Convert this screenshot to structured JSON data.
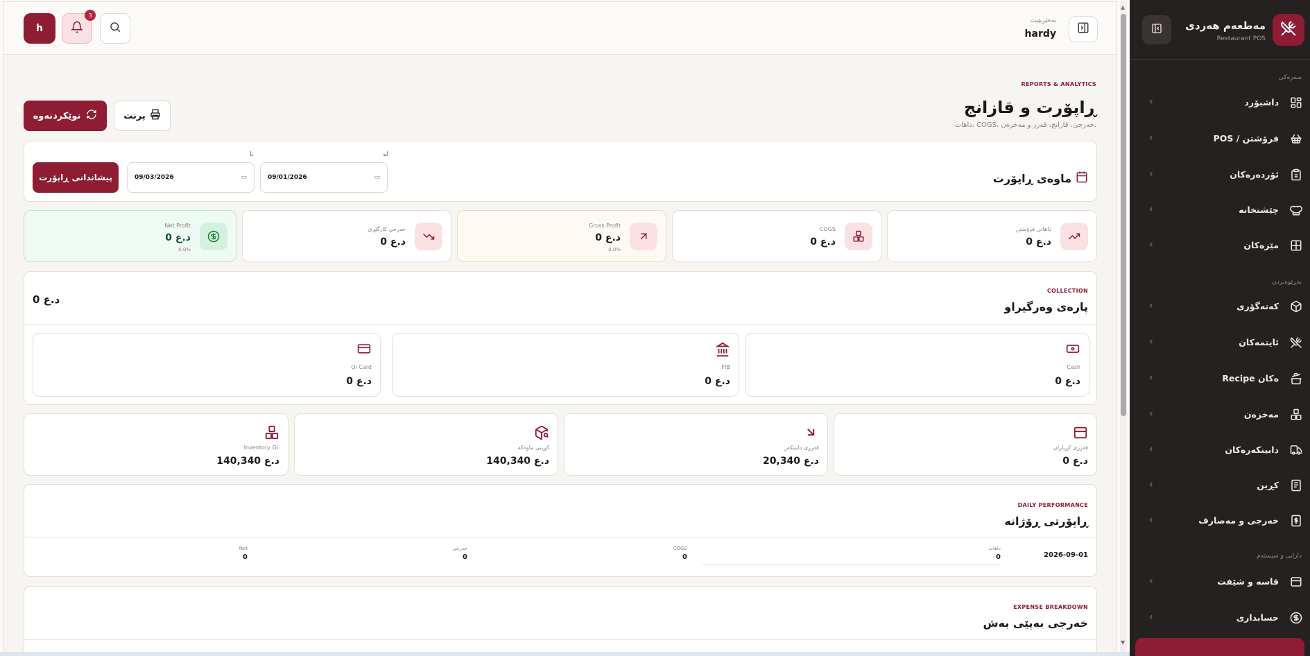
{
  "topbar": {
    "avatar_initial": "h",
    "notifications_count": "3",
    "welcome_label": "بەخێربێیت",
    "username": "hardy"
  },
  "sidebar": {
    "brand_name": "مەطعەم هەردی",
    "brand_sub": "Restaurant POS",
    "sections": {
      "main": "سەرەکی",
      "management": "بەڕێوەبردن",
      "finance": "دارایی و سیستەم"
    },
    "items": [
      {
        "label": "داشبۆرد",
        "icon": "dashboard-icon"
      },
      {
        "label": "POS / فرۆشتن",
        "icon": "basket-icon"
      },
      {
        "label": "ئۆردەرەکان",
        "icon": "clipboard-icon"
      },
      {
        "label": "چێشتخانە",
        "icon": "chef-hat-icon"
      },
      {
        "label": "مێزەکان",
        "icon": "table-grid-icon"
      },
      {
        "label": "کەتەگۆری",
        "icon": "box-icon"
      },
      {
        "label": "ئایتمەکان",
        "icon": "utensils-icon"
      },
      {
        "label": "Recipe ەکان",
        "icon": "cooking-pot-icon"
      },
      {
        "label": "مەخزەن",
        "icon": "boxes-icon"
      },
      {
        "label": "دابینکەرەکان",
        "icon": "truck-icon"
      },
      {
        "label": "کڕین",
        "icon": "receipt-icon"
      },
      {
        "label": "خەرجی و مەصارف",
        "icon": "dollar-receipt-icon"
      },
      {
        "label": "قاسە و شێفت",
        "icon": "cash-register-icon"
      },
      {
        "label": "حسابداری",
        "icon": "dollar-circle-icon"
      }
    ]
  },
  "page": {
    "eyebrow": "REPORTS & ANALYTICS",
    "title": "ڕاپۆرت و قازانج",
    "subtitle": "داهات، COGS، خەرجی، قازانج، قەرز و مەخزەن.",
    "refresh_label": "نوێکردنەوە",
    "print_label": "پرنت"
  },
  "filter": {
    "title": "ماوەی ڕاپۆرت",
    "from_label": "لە",
    "to_label": "تا",
    "from_value": "09/01/2026",
    "to_value": "09/03/2026",
    "show_button": "پیشاندانی ڕاپۆرت"
  },
  "kpis": [
    {
      "label": "داهاتی فرۆشتن",
      "value": "0 د.ع",
      "sub": "",
      "icon": "trending-up-icon"
    },
    {
      "label": "COGS",
      "value": "0 د.ع",
      "sub": "",
      "icon": "boxes-icon"
    },
    {
      "label": "Gross Profit",
      "value": "0 د.ع",
      "sub": "0.0%",
      "icon": "arrow-up-right-icon"
    },
    {
      "label": "خەرجی کارگێڕی",
      "value": "0 د.ع",
      "sub": "",
      "icon": "trending-down-icon"
    },
    {
      "label": "Net Profit",
      "value": "0 د.ع",
      "sub": "0.0%",
      "icon": "dollar-circle-icon"
    }
  ],
  "collection": {
    "eyebrow": "COLLECTION",
    "title": "پارەی وەرگیراو",
    "total": "0 د.ع",
    "methods": [
      {
        "label": "Cash",
        "value": "0 د.ع",
        "icon": "banknote-icon"
      },
      {
        "label": "FIB",
        "value": "0 د.ع",
        "icon": "bank-icon"
      },
      {
        "label": "Qi Card",
        "value": "0 د.ع",
        "icon": "credit-card-icon"
      }
    ]
  },
  "balances": [
    {
      "label": "قەرزی کڕیاران",
      "value": "0 د.ع",
      "icon": "wallet-icon"
    },
    {
      "label": "قەرزی دابینکەر",
      "value": "20,340 د.ع",
      "icon": "arrow-down-right-icon"
    },
    {
      "label": "کڕینی ماوەکە",
      "value": "140,340 د.ع",
      "icon": "package-search-icon"
    },
    {
      "label": "Inventory GL",
      "value": "140,340 د.ع",
      "icon": "boxes-icon"
    }
  ],
  "daily": {
    "eyebrow": "DAILY PERFORMANCE",
    "title": "ڕاپۆرتی ڕۆژانە",
    "row": {
      "date": "2026-09-01",
      "revenue_label": "داهات",
      "revenue": "0",
      "cogs_label": "COGS",
      "cogs": "0",
      "expense_label": "خەرجی",
      "expense": "0",
      "net_label": "Net",
      "net": "0"
    }
  },
  "expense": {
    "eyebrow": "EXPENSE BREAKDOWN",
    "title": "خەرجی بەپێی بەش"
  },
  "colors": {
    "accent": "#8e1c33",
    "sidebar_bg": "#262121",
    "icon_bg": "#fae1e4"
  }
}
